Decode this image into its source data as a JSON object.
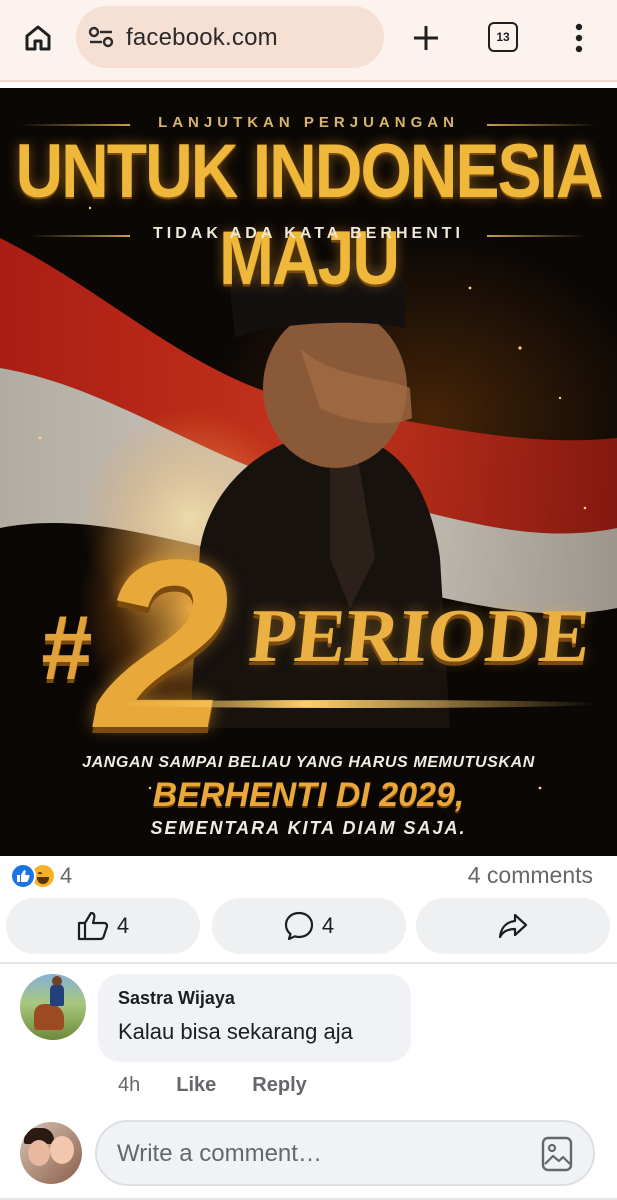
{
  "browser": {
    "url": "facebook.com",
    "tab_count": "13",
    "icons": [
      "home-icon",
      "site-settings-icon",
      "new-tab-plus-icon",
      "tab-switcher-icon",
      "more-vert-icon"
    ],
    "colors": {
      "toolbar_bg": "#fdf3ee",
      "url_pill_bg": "#f6dfd3"
    }
  },
  "post": {
    "image": {
      "kicker": "LANJUTKAN PERJUANGAN",
      "headline": "UNTUK INDONESIA MAJU",
      "subheadline": "TIDAK ADA KATA BERHENTI",
      "hash": "#",
      "number": "2",
      "periode": "PERIODE",
      "line1": "JANGAN SAMPAI BELIAU YANG HARUS MEMUTUSKAN",
      "line2": "BERHENTI DI 2029,",
      "line3": "SEMENTARA KITA DIAM SAJA.",
      "colors": {
        "gold": "#eab142",
        "flag_red": "#c4261a",
        "flag_white": "#e9e4dc",
        "background": "#0a0705"
      }
    },
    "reactions": {
      "types": [
        "like",
        "haha"
      ],
      "count": "4"
    },
    "comments_summary": "4 comments",
    "actions": {
      "like": {
        "icon": "thumbs-up-icon",
        "count": "4"
      },
      "comment": {
        "icon": "comment-bubble-icon",
        "count": "4"
      },
      "share": {
        "icon": "share-arrow-icon"
      }
    }
  },
  "comments": [
    {
      "author": "Sastra Wijaya",
      "text": "Kalau bisa sekarang aja",
      "time": "4h",
      "like_label": "Like",
      "reply_label": "Reply"
    }
  ],
  "composer": {
    "placeholder": "Write a comment…",
    "icon": "image-icon"
  },
  "colors": {
    "facebook_blue": "#1b74e4",
    "secondary_text": "#65676b",
    "button_bg": "#eff0f2"
  }
}
